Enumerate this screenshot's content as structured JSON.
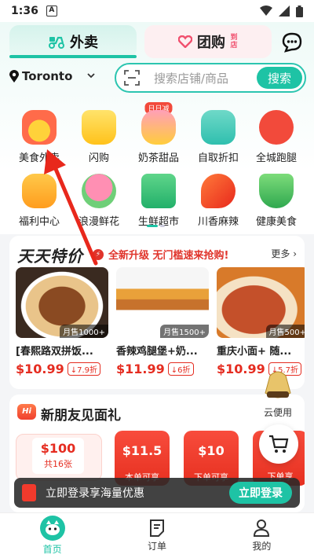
{
  "status_bar": {
    "time": "1:36",
    "indicator": "A"
  },
  "tabs": {
    "waimai": "外卖",
    "tuangou": "团购",
    "tuangou_badge": "到店"
  },
  "location": {
    "city": "Toronto"
  },
  "search": {
    "placeholder": "搜索店铺/商品",
    "button": "搜索"
  },
  "categories": [
    {
      "label": "美食外卖"
    },
    {
      "label": "闪购"
    },
    {
      "label": "奶茶甜品",
      "tag": "日日减"
    },
    {
      "label": "自取折扣"
    },
    {
      "label": "全城跑腿"
    },
    {
      "label": "福利中心"
    },
    {
      "label": "浪漫鲜花"
    },
    {
      "label": "生鲜超市"
    },
    {
      "label": "川香麻辣"
    },
    {
      "label": "健康美食"
    }
  ],
  "deals": {
    "title": "天天特价",
    "subtitle": "全新升级 无门槛速来抢购!",
    "more": "更多",
    "items": [
      {
        "name": "[春熙路双拼饭...",
        "price": "$10.99",
        "off": "7.9折",
        "sales": "月售1000+"
      },
      {
        "name": "香辣鸡腿堡+奶...",
        "price": "$11.99",
        "off": "6折",
        "sales": "月售1500+"
      },
      {
        "name": "重庆小面+ 随...",
        "price": "$10.99",
        "off": "5.7折",
        "sales": "月售500+"
      }
    ]
  },
  "promo": {
    "title": "新朋友见面礼",
    "logo": "Hi",
    "big_coupon": {
      "amount": "$100",
      "count": "共16张"
    },
    "coupons": [
      {
        "amount": "$11.5",
        "note": "本单可享"
      },
      {
        "amount": "$10",
        "note": "下单可享"
      },
      {
        "amount": "",
        "note": "下单享"
      }
    ]
  },
  "vip": {
    "label": "云便用"
  },
  "login_bar": {
    "text": "立即登录享海量优惠",
    "button": "立即登录"
  },
  "bottom_nav": {
    "home": "首页",
    "orders": "订单",
    "me": "我的"
  },
  "colors": {
    "brand": "#1ec3a5",
    "price": "#e52c20",
    "arrow": "#e8281c"
  }
}
